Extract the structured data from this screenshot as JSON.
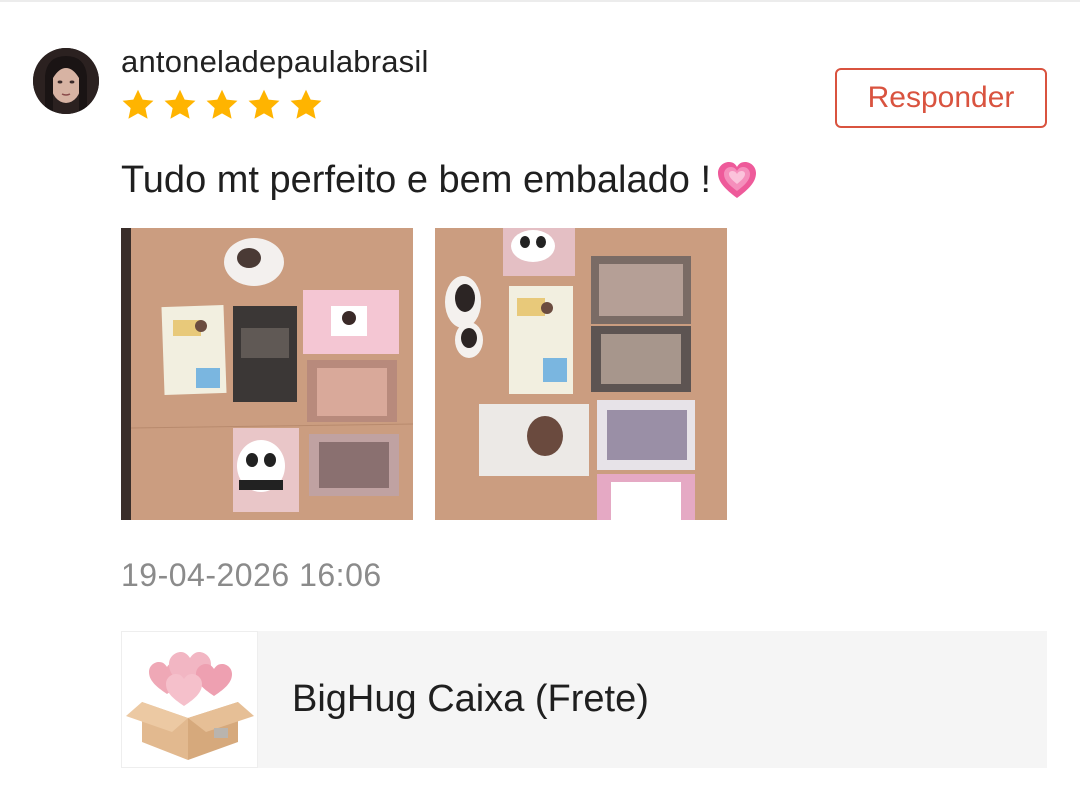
{
  "review": {
    "username": "antoneladepaulabrasil",
    "rating": 5,
    "reply_label": "Responder",
    "comment_text": "Tudo mt perfeito e bem embalado !",
    "comment_emoji": "growing-heart-icon",
    "photos": [
      "review-photo-1",
      "review-photo-2"
    ],
    "timestamp": "19-04-2026 16:06"
  },
  "product": {
    "name": "BigHug Caixa (Frete)",
    "thumbnail_icon": "heart-box-icon"
  },
  "colors": {
    "accent": "#d9533f",
    "star": "#ffb400",
    "timestamp": "#8b8b8b",
    "card_bg": "#f5f5f5"
  }
}
